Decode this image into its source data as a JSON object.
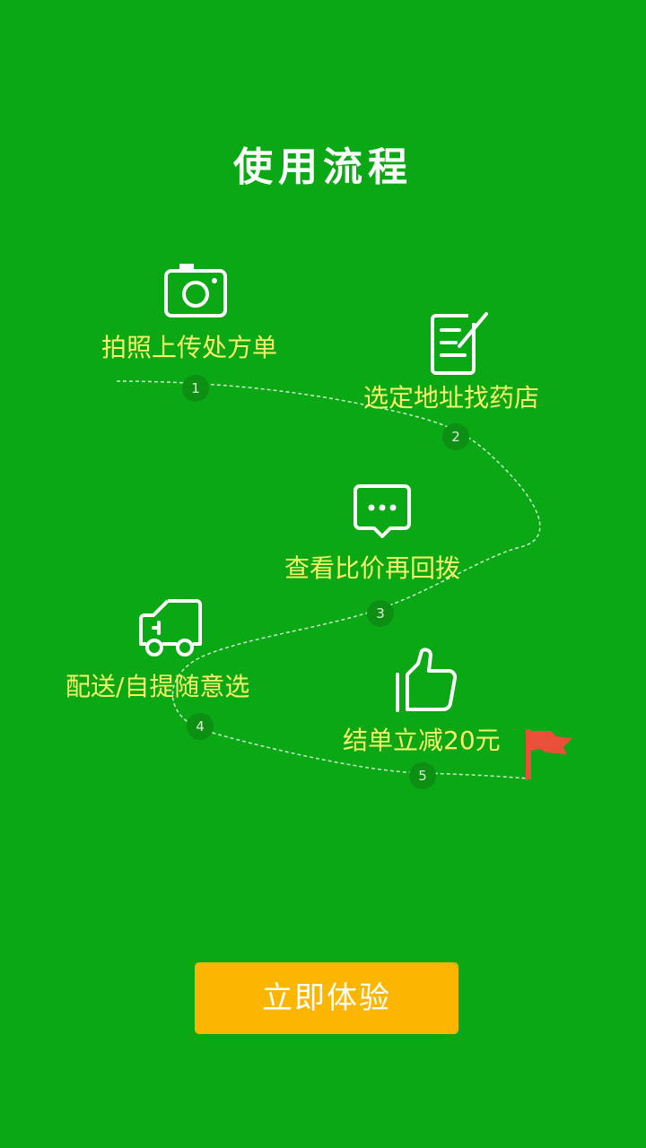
{
  "title": "使用流程",
  "steps": [
    {
      "num": "1",
      "label": "拍照上传处方单",
      "icon": "camera-icon"
    },
    {
      "num": "2",
      "label": "选定地址找药店",
      "icon": "edit-note-icon"
    },
    {
      "num": "3",
      "label": "查看比价再回拨",
      "icon": "chat-bubble-icon"
    },
    {
      "num": "4",
      "label": "配送/自提随意选",
      "icon": "truck-icon"
    },
    {
      "num": "5",
      "label": "结单立减20元",
      "icon": "thumbs-up-icon"
    }
  ],
  "finish_icon": "red-flag-icon",
  "cta_label": "立即体验",
  "colors": {
    "background": "#0aa814",
    "label": "#f6f36a",
    "cta": "#fdb600",
    "flag": "#e8503a"
  }
}
